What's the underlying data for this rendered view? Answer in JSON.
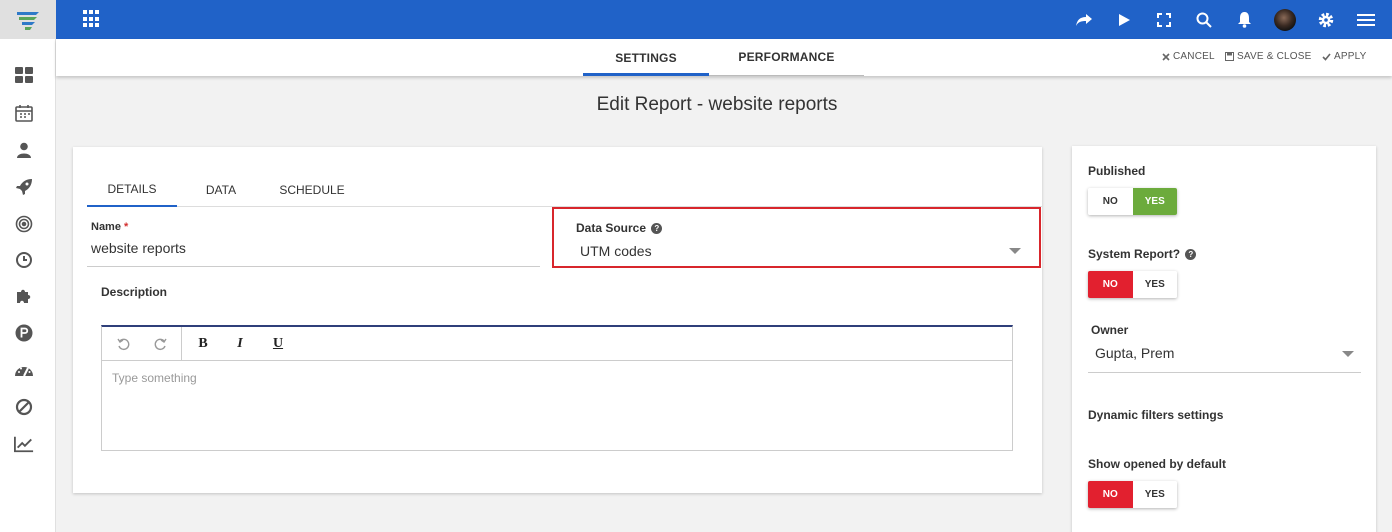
{
  "header": {
    "icons": [
      "share-icon",
      "play-icon",
      "fullscreen-icon",
      "search-icon",
      "bell-icon",
      "avatar",
      "gear-icon",
      "menu-icon"
    ]
  },
  "sidebar": {
    "icons": [
      "dashboard-icon",
      "calendar-icon",
      "user-icon",
      "rocket-icon",
      "target-icon",
      "clock-icon",
      "puzzle-icon",
      "p-circle-icon",
      "gauge-icon",
      "ban-icon",
      "chart-line-icon"
    ]
  },
  "subheader": {
    "tabs": [
      {
        "label": "SETTINGS",
        "active": true
      },
      {
        "label": "PERFORMANCE",
        "active": false
      }
    ],
    "actions": {
      "cancel": "CANCEL",
      "save_close": "SAVE & CLOSE",
      "apply": "APPLY"
    }
  },
  "page": {
    "title": "Edit Report - website reports"
  },
  "form": {
    "tabs": [
      {
        "label": "DETAILS",
        "active": true
      },
      {
        "label": "DATA",
        "active": false
      },
      {
        "label": "SCHEDULE",
        "active": false
      }
    ],
    "name": {
      "label": "Name",
      "required_mark": "*",
      "value": "website reports"
    },
    "data_source": {
      "label": "Data Source",
      "value": "UTM codes"
    },
    "description": {
      "label": "Description",
      "placeholder": "Type something",
      "toolbar": {
        "bold": "B",
        "italic": "I",
        "underline": "U"
      }
    }
  },
  "right_panel": {
    "published": {
      "label": "Published",
      "no": "NO",
      "yes": "YES",
      "selected": "YES"
    },
    "system_report": {
      "label": "System Report?",
      "no": "NO",
      "yes": "YES",
      "selected": "NO"
    },
    "owner": {
      "label": "Owner",
      "value": "Gupta, Prem"
    },
    "dynamic_filters": {
      "label": "Dynamic filters settings"
    },
    "show_opened": {
      "label": "Show opened by default",
      "no": "NO",
      "yes": "YES",
      "selected": "NO"
    }
  },
  "colors": {
    "brand_blue": "#2062c8",
    "toggle_yes": "#6cab3c",
    "toggle_no": "#e2202f",
    "highlight": "#d8262c"
  }
}
